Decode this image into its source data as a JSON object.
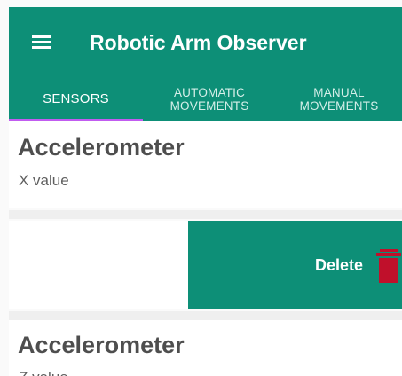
{
  "appbar": {
    "title": "Robotic Arm Observer",
    "menu_icon": "hamburger-menu-icon",
    "color": "#0d8f77"
  },
  "tabs": {
    "items": [
      {
        "label": "SENSORS",
        "selected": true
      },
      {
        "label": "AUTOMATIC\nMOVEMENTS",
        "selected": false
      },
      {
        "label": "MANUAL\nMOVEMENTS",
        "selected": false
      }
    ],
    "indicator_color": "#c15cf0"
  },
  "sensors": [
    {
      "title": "Accelerometer",
      "subtitle": "X value"
    },
    {
      "title": "Accelerometer",
      "subtitle": "Z value"
    }
  ],
  "swipe_action": {
    "label": "Delete",
    "icon": "trash-icon",
    "icon_color": "#c0102b"
  }
}
